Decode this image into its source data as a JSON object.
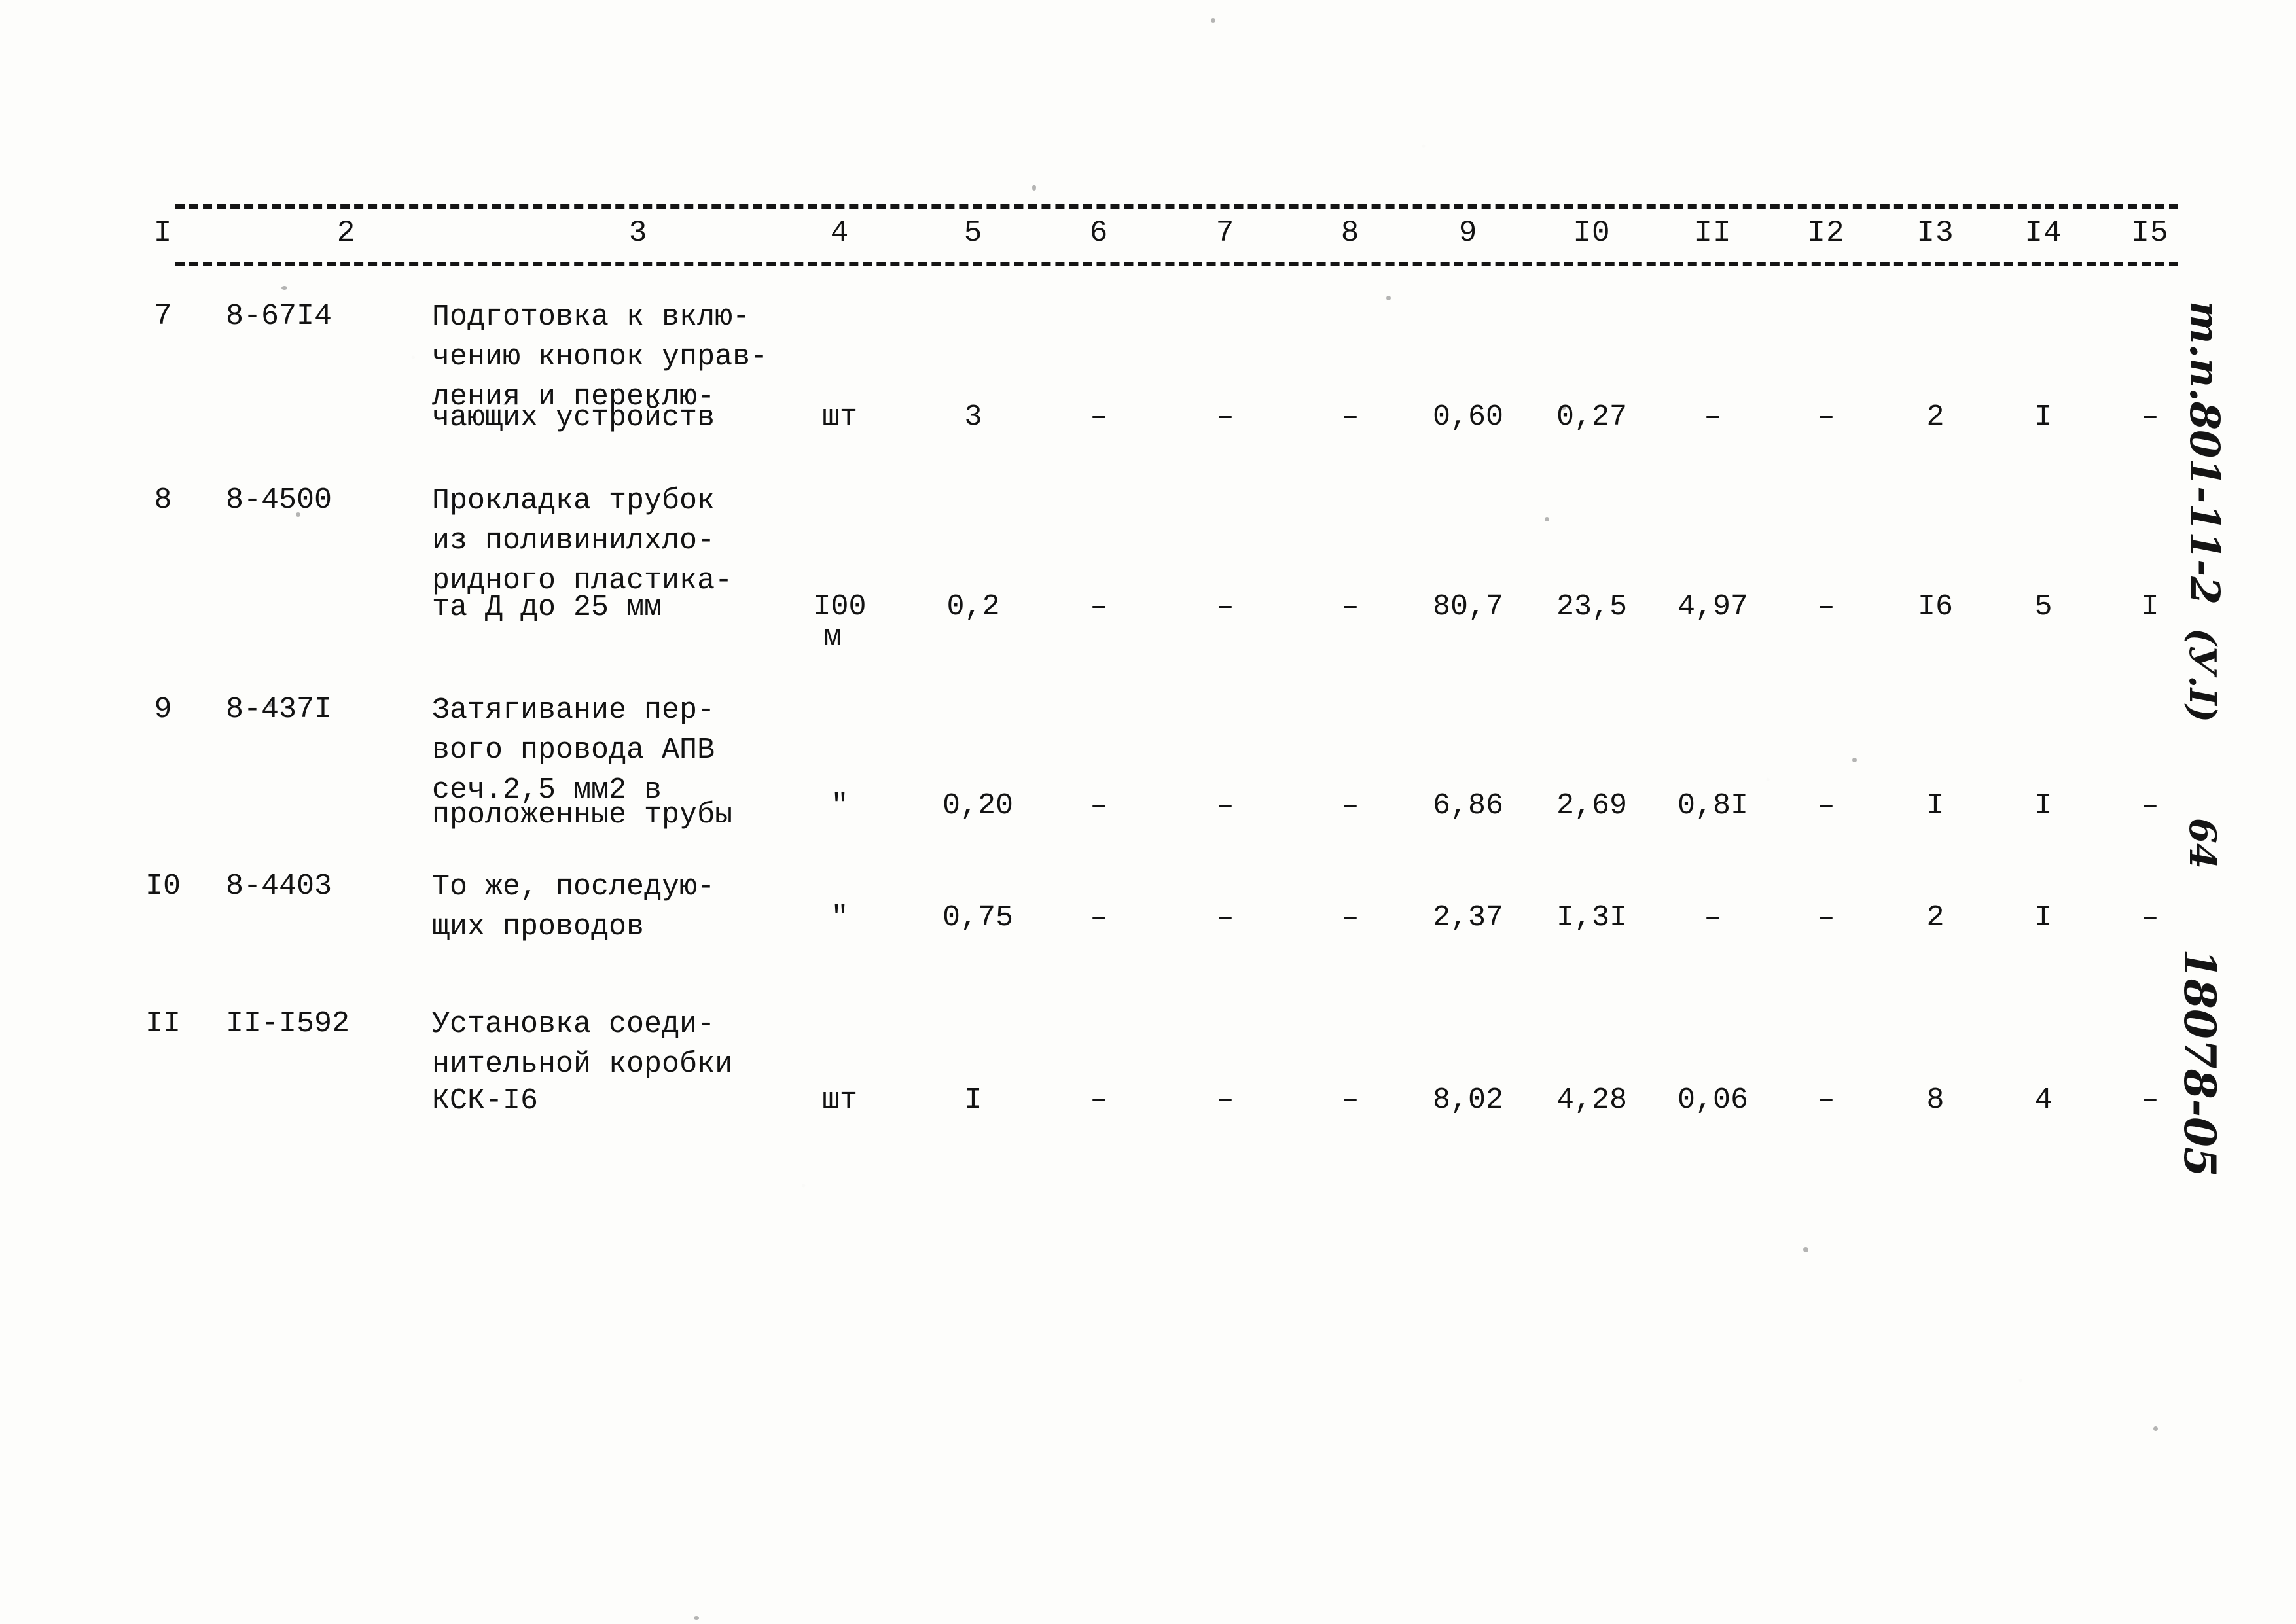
{
  "document": {
    "kind": "scanned-typewritten-table",
    "language": "ru"
  },
  "table": {
    "column_headers": [
      "I",
      "2",
      "3",
      "4",
      "5",
      "6",
      "7",
      "8",
      "9",
      "I0",
      "II",
      "I2",
      "I3",
      "I4",
      "I5"
    ],
    "rows": [
      {
        "num": "7",
        "code": "8-67I4",
        "name_lines": [
          "Подготовка к вклю-",
          "чению кнопок управ-",
          "ления и переклю-",
          "чающих устройств"
        ],
        "unit_lines": [
          "шт"
        ],
        "values": [
          "3",
          "–",
          "–",
          "–",
          "0,60",
          "0,27",
          "–",
          "–",
          "2",
          "I",
          "–"
        ]
      },
      {
        "num": "8",
        "code": "8-4500",
        "name_lines": [
          "Прокладка трубок",
          "из поливинилхло-",
          "ридного пластика-",
          "та Д до 25 мм"
        ],
        "unit_lines": [
          "I00",
          "м"
        ],
        "values": [
          "0,2",
          "–",
          "–",
          "–",
          "80,7",
          "23,5",
          "4,97",
          "–",
          "I6",
          "5",
          "I"
        ]
      },
      {
        "num": "9",
        "code": "8-437I",
        "name_lines": [
          "Затягивание пер-",
          "вого провода АПВ",
          "сеч.2,5 мм2 в",
          "проложенные трубы"
        ],
        "unit_lines": [
          "\""
        ],
        "values": [
          "0,20",
          "–",
          "–",
          "–",
          "6,86",
          "2,69",
          "0,8I",
          "–",
          "I",
          "I",
          "–"
        ]
      },
      {
        "num": "I0",
        "code": "8-4403",
        "name_lines": [
          "То же, последую-",
          "щих проводов"
        ],
        "unit_lines": [
          "\""
        ],
        "values": [
          "0,75",
          "–",
          "–",
          "–",
          "2,37",
          "I,3I",
          "–",
          "–",
          "2",
          "I",
          "–"
        ]
      },
      {
        "num": "II",
        "code": "II-I592",
        "name_lines": [
          "Установка соеди-",
          "нительной коробки",
          "КСК-I6"
        ],
        "unit_lines": [
          "шт"
        ],
        "values": [
          "I",
          "–",
          "–",
          "–",
          "8,02",
          "4,28",
          "0,06",
          "–",
          "8",
          "4",
          "–"
        ]
      }
    ]
  },
  "margin_notes": {
    "series": "т.п.801-11-2",
    "variant": "(У.I)",
    "page": "64",
    "archive_code": "18078-05"
  }
}
